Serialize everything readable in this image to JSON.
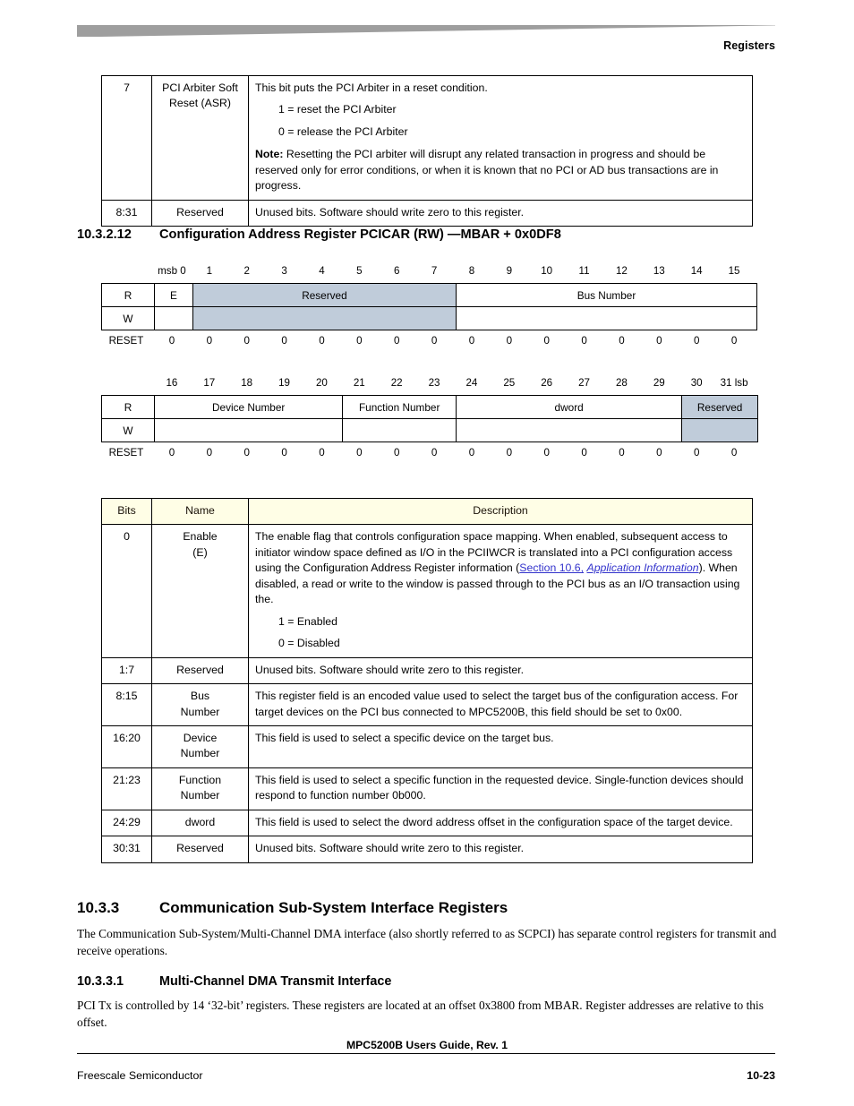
{
  "header": {
    "running_title": "Registers"
  },
  "top_table": {
    "rows": [
      {
        "bits": "7",
        "name_l1": "PCI Arbiter Soft",
        "name_l2": "Reset (ASR)",
        "desc_intro": "This bit puts the PCI Arbiter in a reset condition.",
        "opt1": "1 = reset the PCI Arbiter",
        "opt0": "0 = release the PCI Arbiter",
        "note_label": "Note:",
        "note_text": "Resetting the PCI arbiter will disrupt any related transaction in progress and should be reserved only for error conditions, or when it is known that no PCI or AD bus transactions are in progress."
      },
      {
        "bits": "8:31",
        "name_l1": "Reserved",
        "desc_intro": "Unused bits. Software should write zero to this register."
      }
    ]
  },
  "section_10_3_2_12": {
    "number": "10.3.2.12",
    "title": "Configuration Address Register PCICAR (RW) —MBAR + 0x0DF8"
  },
  "register_upper": {
    "bit_labels": [
      "msb 0",
      "1",
      "2",
      "3",
      "4",
      "5",
      "6",
      "7",
      "8",
      "9",
      "10",
      "11",
      "12",
      "13",
      "14",
      "15"
    ],
    "read_label": "R",
    "write_label": "W",
    "fields": [
      {
        "label": "E",
        "span": 1,
        "shaded": false
      },
      {
        "label": "Reserved",
        "span": 7,
        "shaded": true
      },
      {
        "label": "Bus Number",
        "span": 8,
        "shaded": false
      }
    ],
    "reset_label": "RESET",
    "reset_values": [
      "0",
      "0",
      "0",
      "0",
      "0",
      "0",
      "0",
      "0",
      "0",
      "0",
      "0",
      "0",
      "0",
      "0",
      "0",
      "0"
    ]
  },
  "register_lower": {
    "bit_labels": [
      "16",
      "17",
      "18",
      "19",
      "20",
      "21",
      "22",
      "23",
      "24",
      "25",
      "26",
      "27",
      "28",
      "29",
      "30",
      "31 lsb"
    ],
    "read_label": "R",
    "write_label": "W",
    "fields": [
      {
        "label": "Device Number",
        "span": 5,
        "shaded": false
      },
      {
        "label": "Function Number",
        "span": 3,
        "shaded": false
      },
      {
        "label": "dword",
        "span": 6,
        "shaded": false
      },
      {
        "label": "Reserved",
        "span": 2,
        "shaded": true
      }
    ],
    "reset_label": "RESET",
    "reset_values": [
      "0",
      "0",
      "0",
      "0",
      "0",
      "0",
      "0",
      "0",
      "0",
      "0",
      "0",
      "0",
      "0",
      "0",
      "0",
      "0"
    ]
  },
  "desc_table": {
    "headers": [
      "Bits",
      "Name",
      "Description"
    ],
    "rows": [
      {
        "bits": "0",
        "name_l1": "Enable",
        "name_l2": "(E)",
        "desc_part1": "The enable flag that controls configuration space mapping. When enabled, subsequent access to initiator window space defined as I/O in the PCIIWCR is translated into a PCI configuration access using the Configuration Address Register information (",
        "link_text": "Section 10.6,",
        "link_text_italic": "Application Information",
        "desc_part2": "). When disabled, a read or write to the window is passed through to the PCI bus as an I/O transaction using the.",
        "opt1": "1 = Enabled",
        "opt0": "0 = Disabled"
      },
      {
        "bits": "1:7",
        "name_l1": "Reserved",
        "desc_part1": "Unused bits. Software should write zero to this register."
      },
      {
        "bits": "8:15",
        "name_l1": "Bus",
        "name_l2": "Number",
        "desc_part1": "This register field is an encoded value used to select the target bus of the configuration access. For target devices on the PCI bus connected to MPC5200B, this field should be set to 0x00."
      },
      {
        "bits": "16:20",
        "name_l1": "Device",
        "name_l2": "Number",
        "desc_part1": "This field is used to select a specific device on the target bus."
      },
      {
        "bits": "21:23",
        "name_l1": "Function",
        "name_l2": "Number",
        "desc_part1": "This field is used to select a specific function in the requested device. Single-function devices should respond to function number 0b000."
      },
      {
        "bits": "24:29",
        "name_l1": "dword",
        "desc_part1": "This field is used to select the dword address offset in the configuration space of the target device."
      },
      {
        "bits": "30:31",
        "name_l1": "Reserved",
        "desc_part1": "Unused bits. Software should write zero to this register."
      }
    ]
  },
  "section_10_3_3": {
    "number": "10.3.3",
    "title": "Communication Sub-System Interface Registers",
    "body": "The Communication Sub-System/Multi-Channel DMA interface (also shortly referred to as SCPCI) has separate control registers for transmit and receive operations."
  },
  "section_10_3_3_1": {
    "number": "10.3.3.1",
    "title": "Multi-Channel DMA Transmit Interface",
    "body": "PCI Tx is controlled by 14 ‘32-bit’ registers. These registers are located at an offset 0x3800 from MBAR. Register addresses are relative to this offset."
  },
  "footer": {
    "center": "MPC5200B Users Guide, Rev. 1",
    "left": "Freescale Semiconductor",
    "right": "10-23"
  },
  "colors": {
    "banner_gray": "#9e9e9e",
    "reserved_shade": "#c0ccda",
    "table_header_bg": "#fffee6",
    "link_blue": "#3333cc"
  }
}
